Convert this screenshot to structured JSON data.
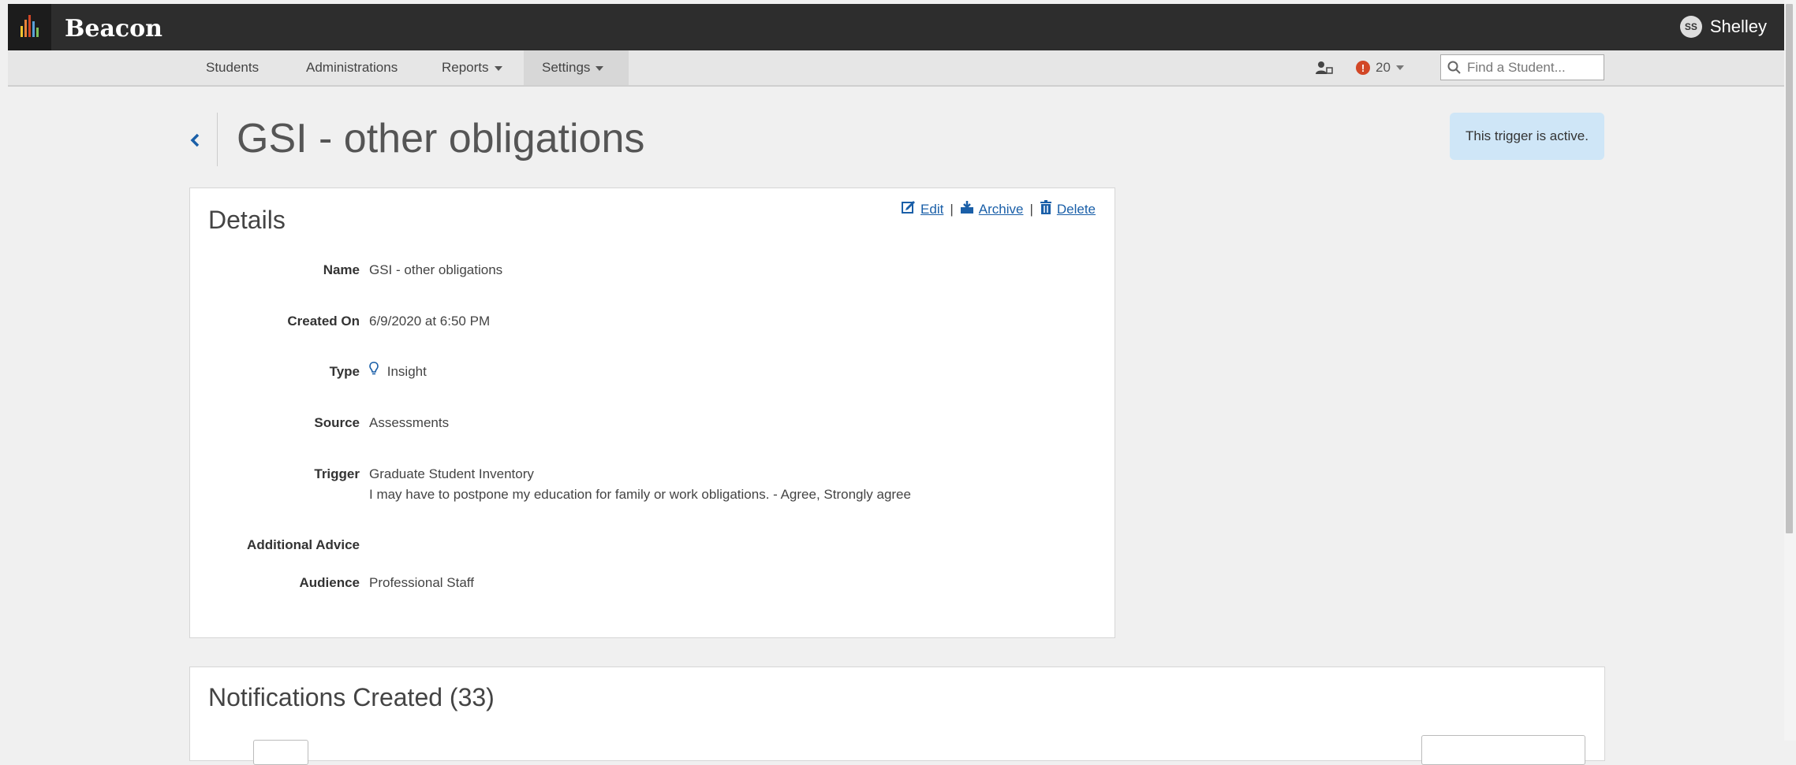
{
  "app": {
    "brand": "Beacon",
    "user_initials": "SS",
    "user_name": "Shelley"
  },
  "nav": {
    "items": [
      {
        "label": "Students"
      },
      {
        "label": "Administrations"
      },
      {
        "label": "Reports"
      },
      {
        "label": "Settings"
      }
    ],
    "alert_count": "20",
    "search_placeholder": "Find a Student..."
  },
  "page": {
    "title": "GSI - other obligations",
    "status_note": "This trigger is active."
  },
  "details": {
    "heading": "Details",
    "actions": {
      "edit": "Edit",
      "archive": "Archive",
      "delete": "Delete"
    },
    "fields": {
      "name_label": "Name",
      "name_value": "GSI - other obligations",
      "created_label": "Created On",
      "created_value": "6/9/2020 at 6:50 PM",
      "type_label": "Type",
      "type_value": "Insight",
      "source_label": "Source",
      "source_value": "Assessments",
      "trigger_label": "Trigger",
      "trigger_line1": "Graduate Student Inventory",
      "trigger_line2": "I may have to postpone my education for family or work obligations. - Agree, Strongly agree",
      "advice_label": "Additional Advice",
      "advice_value": "",
      "audience_label": "Audience",
      "audience_value": "Professional Staff"
    }
  },
  "notifications": {
    "heading": "Notifications Created (33)"
  },
  "icons": {
    "logo": "logo-bars-icon",
    "user_switch": "user-icon",
    "alert": "alert-icon",
    "search": "search-icon",
    "back": "chevron-left-icon",
    "edit": "edit-icon",
    "archive": "archive-icon",
    "delete": "trash-icon",
    "type": "lightbulb-icon"
  },
  "colors": {
    "topbar": "#2d2d2d",
    "link": "#1a5fa8",
    "alert": "#d24726",
    "status_note_bg": "#cfe6f7"
  }
}
